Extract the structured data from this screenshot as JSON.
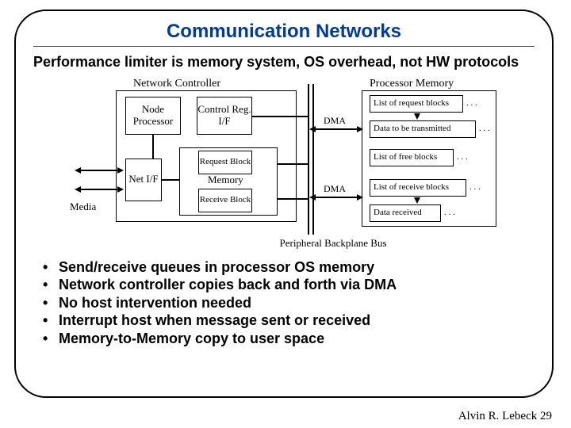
{
  "title": "Communication Networks",
  "subtitle": "Performance limiter is memory system, OS overhead, not HW protocols",
  "diagram": {
    "network_controller_label": "Network Controller",
    "node_processor": "Node Processor",
    "control_reg_if": "Control Reg. I/F",
    "net_if": "Net I/F",
    "memory": "Memory",
    "request_block": "Request Block",
    "receive_block": "Receive Block",
    "media": "Media",
    "processor_memory_label": "Processor Memory",
    "list_request": "List of request blocks",
    "data_tx": "Data to be transmitted",
    "list_free": "List of free blocks",
    "list_receive": "List of receive blocks",
    "data_rx": "Data received",
    "dma1": "DMA",
    "dma2": "DMA",
    "bus_label": "Peripheral Backplane Bus",
    "dots": ". . ."
  },
  "bullets": [
    "Send/receive queues in processor OS memory",
    "Network controller copies back and forth via DMA",
    "No host intervention needed",
    "Interrupt host when message sent or received",
    "Memory-to-Memory copy to user space"
  ],
  "footer": {
    "author": "Alvin R. Lebeck",
    "page": "29"
  }
}
